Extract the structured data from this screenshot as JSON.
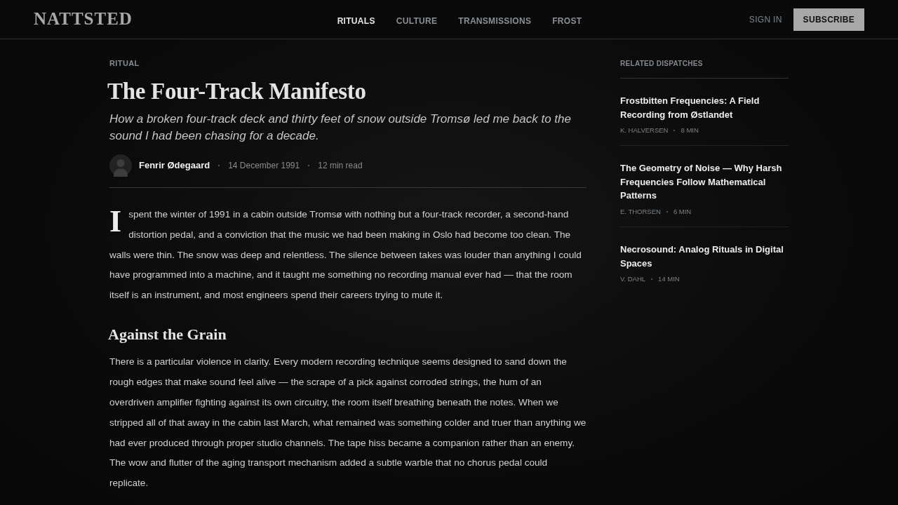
{
  "header": {
    "logo": "NATTSTED",
    "nav": [
      {
        "label": "RITUALS",
        "selected": true
      },
      {
        "label": "CULTURE",
        "selected": false
      },
      {
        "label": "TRANSMISSIONS",
        "selected": false
      },
      {
        "label": "FROST",
        "selected": false
      }
    ],
    "sign_in": "SIGN IN",
    "subscribe": "SUBSCRIBE"
  },
  "article": {
    "category": "RITUAL",
    "title": "The Four-Track Manifesto",
    "subtitle": "How a broken four-track deck and thirty feet of snow outside Tromsø led me back to the sound I had been chasing for a decade.",
    "author": {
      "name": "Fenrir Ødegaard",
      "date": "14 December 1991",
      "read_time": "12 min read"
    },
    "body": [
      {
        "kind": "paragraph",
        "drop_cap": "I",
        "text": "spent the winter of 1991 in a cabin outside Tromsø with nothing but a four-track recorder, a second-hand distortion pedal, and a conviction that the music we had been making in Oslo had become too clean. The walls were thin. The snow was deep and relentless. The silence between takes was louder than anything I could have programmed into a machine, and it taught me something no recording manual ever had — that the room itself is an instrument, and most engineers spend their careers trying to mute it."
      },
      {
        "kind": "heading",
        "text": "Against the Grain"
      },
      {
        "kind": "paragraph",
        "text": "There is a particular violence in clarity. Every modern recording technique seems designed to sand down the rough edges that make sound feel alive — the scrape of a pick against corroded strings, the hum of an overdriven amplifier fighting against its own circuitry, the room itself breathing beneath the notes. When we stripped all of that away in the cabin last March, what remained was something colder and truer than anything we had ever produced through proper studio channels. The tape hiss became a companion rather than an enemy. The wow and flutter of the aging transport mechanism added a subtle warble that no chorus pedal could replicate."
      }
    ]
  },
  "sidebar": {
    "title": "RELATED DISPATCHES",
    "items": [
      {
        "title": "Frostbitten Frequencies: A Field Recording from Østlandet",
        "author": "K. HALVERSEN",
        "read_time": "8 MIN"
      },
      {
        "title": "The Geometry of Noise — Why Harsh Frequencies Follow Mathematical Patterns",
        "author": "E. THORSEN",
        "read_time": "6 MIN"
      },
      {
        "title": "Necrosound: Analog Rituals in Digital Spaces",
        "author": "V. DAHL",
        "read_time": "14 MIN"
      }
    ]
  }
}
